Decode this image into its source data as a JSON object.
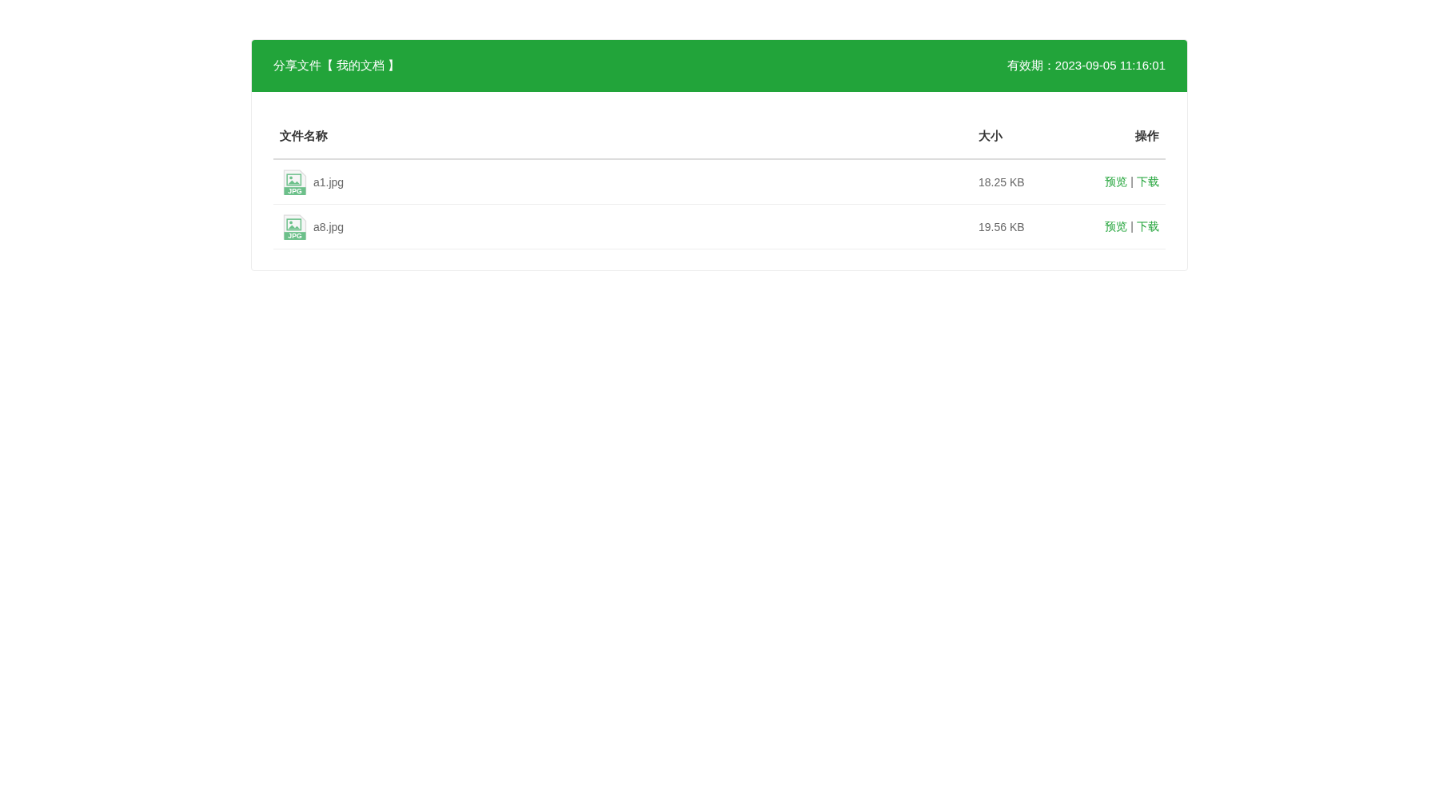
{
  "header": {
    "title": "分享文件【 我的文档 】",
    "expiry": "有效期：2023-09-05 11:16:01"
  },
  "table": {
    "columns": [
      "文件名称",
      "大小",
      "操作"
    ],
    "rows": [
      {
        "name": "a1.jpg",
        "icon_label": "JPG",
        "size": "18.25 KB",
        "actions": [
          "预览",
          "|",
          "下载"
        ]
      },
      {
        "name": "a8.jpg",
        "icon_label": "JPG",
        "size": "19.56 KB",
        "actions": [
          "预览",
          "|",
          "下载"
        ]
      }
    ]
  }
}
